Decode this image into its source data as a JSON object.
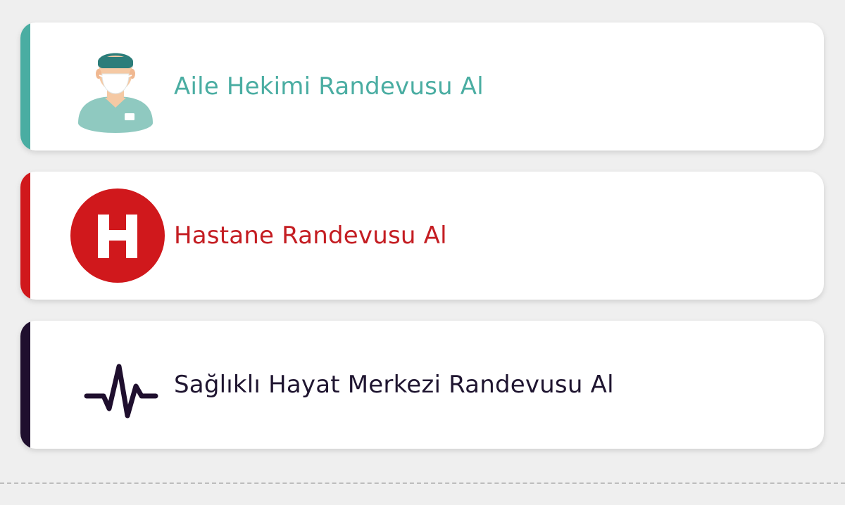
{
  "cards": [
    {
      "label": "Aile Hekimi Randevusu Al",
      "icon": "doctor-icon",
      "accent_color": "#4aada2",
      "text_color": "#4aada2"
    },
    {
      "label": "Hastane Randevusu Al",
      "icon": "hospital-icon",
      "accent_color": "#d0181c",
      "text_color": "#c41d22"
    },
    {
      "label": "Sağlıklı Hayat Merkezi Randevusu Al",
      "icon": "heartbeat-icon",
      "accent_color": "#1f0f2e",
      "text_color": "#1f1530"
    }
  ]
}
